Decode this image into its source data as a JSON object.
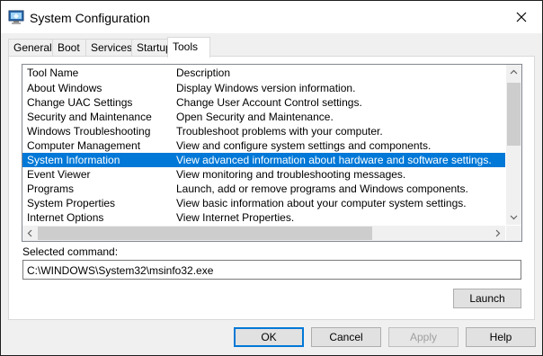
{
  "window": {
    "title": "System Configuration"
  },
  "tabs": [
    "General",
    "Boot",
    "Services",
    "Startup",
    "Tools"
  ],
  "active_tab": "Tools",
  "list": {
    "headers": [
      "Tool Name",
      "Description"
    ],
    "rows": [
      {
        "name": "About Windows",
        "desc": "Display Windows version information."
      },
      {
        "name": "Change UAC Settings",
        "desc": "Change User Account Control settings."
      },
      {
        "name": "Security and Maintenance",
        "desc": "Open Security and Maintenance."
      },
      {
        "name": "Windows Troubleshooting",
        "desc": "Troubleshoot problems with your computer."
      },
      {
        "name": "Computer Management",
        "desc": "View and configure system settings and components."
      },
      {
        "name": "System Information",
        "desc": "View advanced information about hardware and software settings."
      },
      {
        "name": "Event Viewer",
        "desc": "View monitoring and troubleshooting messages."
      },
      {
        "name": "Programs",
        "desc": "Launch, add or remove programs and Windows components."
      },
      {
        "name": "System Properties",
        "desc": "View basic information about your computer system settings."
      },
      {
        "name": "Internet Options",
        "desc": "View Internet Properties."
      }
    ],
    "selected_index": 5
  },
  "selected_command": {
    "label": "Selected command:",
    "value": "C:\\WINDOWS\\System32\\msinfo32.exe"
  },
  "buttons": {
    "launch": "Launch",
    "ok": "OK",
    "cancel": "Cancel",
    "apply": "Apply",
    "help": "Help"
  },
  "colors": {
    "selection": "#0078d7",
    "accent": "#0078d7"
  },
  "icons": [
    "msconfig-app-icon",
    "close-icon",
    "chevron-up-icon",
    "chevron-down-icon",
    "chevron-left-icon",
    "chevron-right-icon"
  ]
}
